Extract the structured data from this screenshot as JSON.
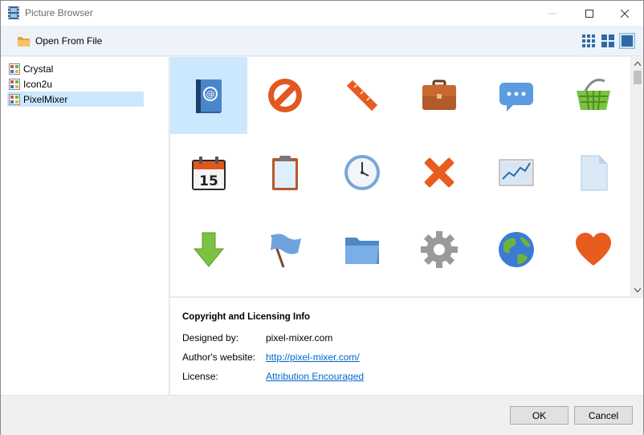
{
  "window": {
    "title": "Picture Browser"
  },
  "toolbar": {
    "open_label": "Open From File",
    "views": [
      {
        "icon": "small-grid-view-icon"
      },
      {
        "icon": "medium-grid-view-icon"
      },
      {
        "icon": "large-view-icon",
        "active": true
      }
    ]
  },
  "tree": {
    "items": [
      {
        "label": "Crystal",
        "selected": false
      },
      {
        "label": "Icon2u",
        "selected": false
      },
      {
        "label": "PixelMixer",
        "selected": true
      }
    ]
  },
  "grid": {
    "icons": [
      {
        "name": "address-book-icon",
        "selected": true
      },
      {
        "name": "forbidden-icon"
      },
      {
        "name": "ruler-icon"
      },
      {
        "name": "briefcase-icon"
      },
      {
        "name": "chat-bubble-icon"
      },
      {
        "name": "shopping-basket-icon"
      },
      {
        "name": "calendar-icon"
      },
      {
        "name": "clipboard-icon"
      },
      {
        "name": "clock-icon"
      },
      {
        "name": "delete-cross-icon"
      },
      {
        "name": "chart-icon"
      },
      {
        "name": "document-icon"
      },
      {
        "name": "download-arrow-icon"
      },
      {
        "name": "flag-icon"
      },
      {
        "name": "folder-icon"
      },
      {
        "name": "gear-icon"
      },
      {
        "name": "globe-icon"
      },
      {
        "name": "heart-icon"
      }
    ],
    "calendar_day": "15"
  },
  "info": {
    "title": "Copyright and Licensing Info",
    "designed_by_label": "Designed by:",
    "designed_by_value": "pixel-mixer.com",
    "website_label": "Author's website:",
    "website_value": "http://pixel-mixer.com/",
    "license_label": "License:",
    "license_value": "Attribution Encouraged"
  },
  "footer": {
    "ok_label": "OK",
    "cancel_label": "Cancel"
  }
}
